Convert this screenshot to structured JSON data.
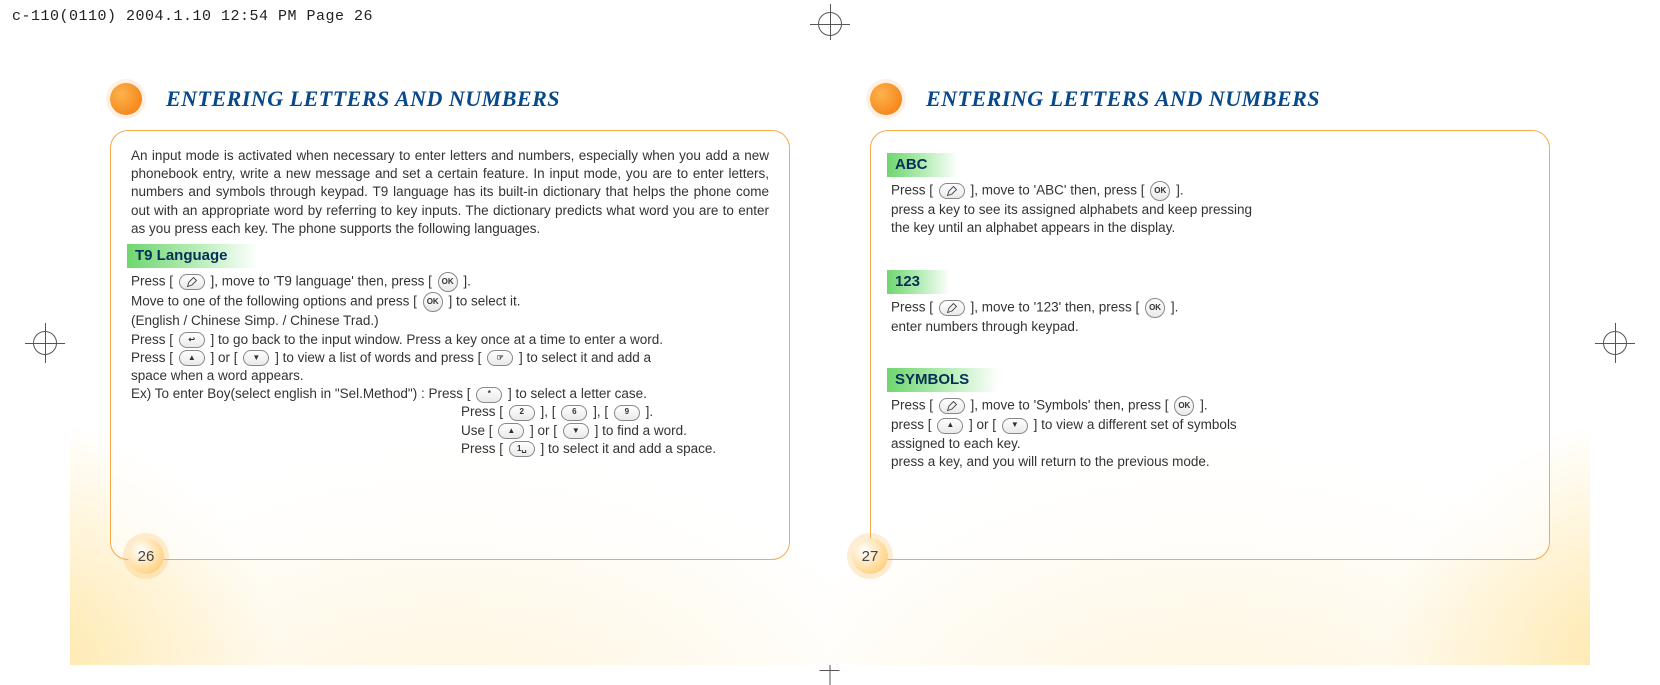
{
  "printmark": "c-110(0110)  2004.1.10  12:54 PM  Page 26",
  "left": {
    "title": "ENTERING LETTERS AND NUMBERS",
    "intro": "An input mode is activated when necessary to enter letters and numbers, especially when you add a new phonebook entry, write a new message and set a certain feature. In input mode, you are to enter letters, numbers and symbols through keypad. T9 language has its built-in dictionary that helps the phone come out with an appropriate word by referring to key inputs. The dictionary predicts what word you are to enter as you press each key. The phone supports the following languages.",
    "sub_t9": "T9 Language",
    "t9_l1a": "Press [",
    "t9_l1b": "], move to 'T9 language' then, press [",
    "t9_l1c": "].",
    "t9_l2a": "Move to one of the following options and press [",
    "t9_l2b": "] to select it.",
    "t9_l3": "(English / Chinese Simp. / Chinese Trad.)",
    "t9_l4a": "Press [",
    "t9_l4b": "] to go back to the input window. Press a key once at a time to enter a word.",
    "t9_l5a": "Press [",
    "t9_l5b": "] or [",
    "t9_l5c": "] to view a list of words and press [",
    "t9_l5d": "] to select it and add a",
    "t9_l6": "space when a word appears.",
    "t9_ex_prefix": "Ex) To enter Boy(select english in \"Sel.Method\") : ",
    "t9_ex_l1a": "Press [",
    "t9_ex_l1b": "] to select a letter case.",
    "t9_ex_l2a": "Press [",
    "t9_ex_l2b": "], [",
    "t9_ex_l2c": "], [",
    "t9_ex_l2d": "].",
    "t9_ex_l3a": "Use [",
    "t9_ex_l3b": "] or [",
    "t9_ex_l3c": "] to find a word.",
    "t9_ex_l4a": "Press [",
    "t9_ex_l4b": "] to select it and add a space.",
    "pagenum": "26"
  },
  "right": {
    "title": "ENTERING LETTERS AND NUMBERS",
    "sub_abc": "ABC",
    "abc_l1a": "Press [",
    "abc_l1b": "], move to 'ABC' then, press [",
    "abc_l1c": "].",
    "abc_l2": "press a key to see its assigned alphabets and keep pressing",
    "abc_l3": "the key until an alphabet appears in the display.",
    "sub_123": "123",
    "n123_l1a": "Press [",
    "n123_l1b": "], move to '123' then, press [",
    "n123_l1c": "].",
    "n123_l2": "enter numbers through keypad.",
    "sub_sym": "SYMBOLS",
    "sym_l1a": "Press [",
    "sym_l1b": "], move to 'Symbols' then, press [",
    "sym_l1c": "].",
    "sym_l2a": "press [",
    "sym_l2b": "] or [",
    "sym_l2c": "] to view a different set of symbols",
    "sym_l3": "assigned to each key.",
    "sym_l4": "press a key, and you will return to the previous mode.",
    "pagenum": "27"
  },
  "icons": {
    "ok": "OK",
    "back": "↩",
    "up": "▲",
    "down": "▼",
    "key_star": "*",
    "key_2": "2",
    "key_6": "6",
    "key_9": "9",
    "key_1u": "1␣",
    "hand": "☞"
  }
}
